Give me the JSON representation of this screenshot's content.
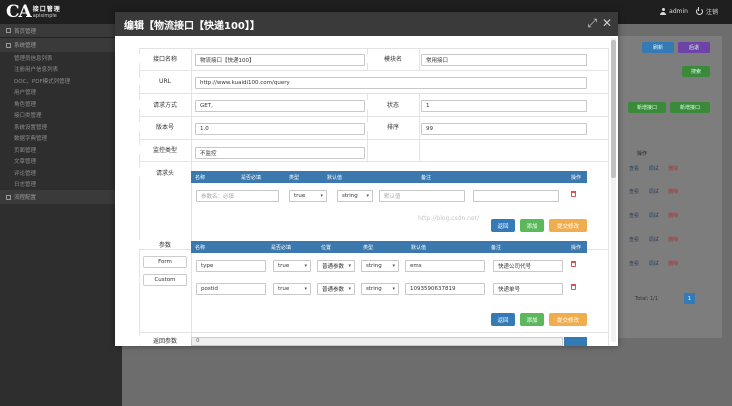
{
  "app": {
    "logo_big": "CA",
    "logo_cn": "接口管理",
    "logo_en": "apisimple",
    "user": "admin",
    "logout": "注销"
  },
  "sidebar": {
    "header": "首页管理",
    "section1": "系统管理",
    "items": [
      "管理员信息列表",
      "注册用户信息列表",
      "DOC、PDF模式列管理",
      "用户管理",
      "角色管理",
      "接口类管理",
      "系统设置管理",
      "数据字典管理",
      "页面管理",
      "文章管理",
      "评论管理",
      "日志管理"
    ],
    "section2": "流程配置"
  },
  "bg": {
    "btn_add": "新增接口",
    "btn_add2": "新增接口",
    "btn_refresh": "刷新",
    "btn_back": "后退",
    "btn_search": "搜索",
    "col_action": "操作",
    "row_actions": [
      "查看",
      "调试",
      "删除"
    ],
    "paging": "Total: 1/1",
    "page": "1"
  },
  "modal": {
    "title": "编辑【物流接口【快递100】】",
    "fields": {
      "name_label": "接口名称",
      "name": "物流接口【快递100】",
      "module_label": "模块名",
      "module": "常用接口",
      "url_label": "URL",
      "url": "http://www.kuaidi100.com/query",
      "method_label": "请求方式",
      "method": "GET,",
      "status_label": "状态",
      "status": "1",
      "version_label": "版本号",
      "version": "1.0",
      "sort_label": "排序",
      "sort": "99",
      "monitor_label": "监控类型",
      "monitor": "不监控"
    },
    "header_section": {
      "label": "请求头",
      "cols": [
        "名称",
        "是否必填",
        "类型",
        "默认值",
        "备注",
        "操作"
      ],
      "row": {
        "name_ph": "参数名：必填",
        "required": "true",
        "type": "string",
        "default_ph": "默认值",
        "remark": ""
      },
      "buttons": [
        "返回",
        "添加",
        "提交修改"
      ]
    },
    "param_section": {
      "label": "参数",
      "side_buttons": [
        "Form",
        "Custom"
      ],
      "cols": [
        "名称",
        "是否必填",
        "位置",
        "类型",
        "默认值",
        "备注",
        "操作"
      ],
      "rows": [
        {
          "name": "type",
          "required": "true",
          "position": "普通参数",
          "type": "string",
          "default": "ems",
          "remark": "快递公司代号"
        },
        {
          "name": "postid",
          "required": "true",
          "position": "普通参数",
          "type": "string",
          "default": "1093590637819",
          "remark": "快递单号"
        }
      ],
      "buttons": [
        "返回",
        "添加",
        "提交修改"
      ]
    },
    "return_section": {
      "label": "返回参数",
      "value": "0"
    },
    "watermark": "http://blog.csdn.net/"
  }
}
